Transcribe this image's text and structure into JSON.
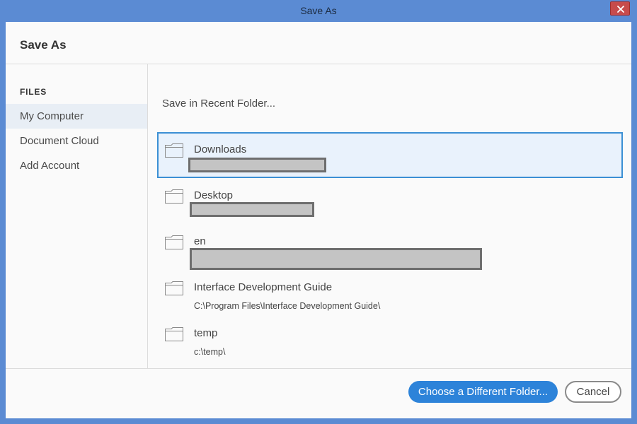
{
  "window": {
    "title": "Save As",
    "close_icon": "close-icon",
    "close_color": "#c74b4b"
  },
  "dialog": {
    "heading": "Save As"
  },
  "sidebar": {
    "section_label": "FILES",
    "items": [
      {
        "label": "My Computer",
        "selected": true
      },
      {
        "label": "Document Cloud",
        "selected": false
      },
      {
        "label": "Add Account",
        "selected": false
      }
    ]
  },
  "main": {
    "recent_label": "Save in Recent Folder...",
    "folders": [
      {
        "name": "Downloads",
        "path": "",
        "path_redacted": true,
        "selected": true,
        "icon": "folder-icon"
      },
      {
        "name": "Desktop",
        "path": "",
        "path_redacted": true,
        "selected": false,
        "icon": "folder-icon"
      },
      {
        "name": "en",
        "path": "",
        "path_redacted": true,
        "selected": false,
        "icon": "folder-icon"
      },
      {
        "name": "Interface Development Guide",
        "path": "C:\\Program Files\\Interface Development Guide\\",
        "path_redacted": false,
        "selected": false,
        "icon": "folder-icon"
      },
      {
        "name": "temp",
        "path": "c:\\temp\\",
        "path_redacted": false,
        "selected": false,
        "icon": "folder-icon"
      }
    ]
  },
  "footer": {
    "choose_label": "Choose a Different Folder...",
    "cancel_label": "Cancel"
  },
  "colors": {
    "accent": "#2d83d9",
    "selection_border": "#3b8fd4",
    "selection_bg": "#e9f2fc",
    "title_bar": "#5b8bd3"
  }
}
